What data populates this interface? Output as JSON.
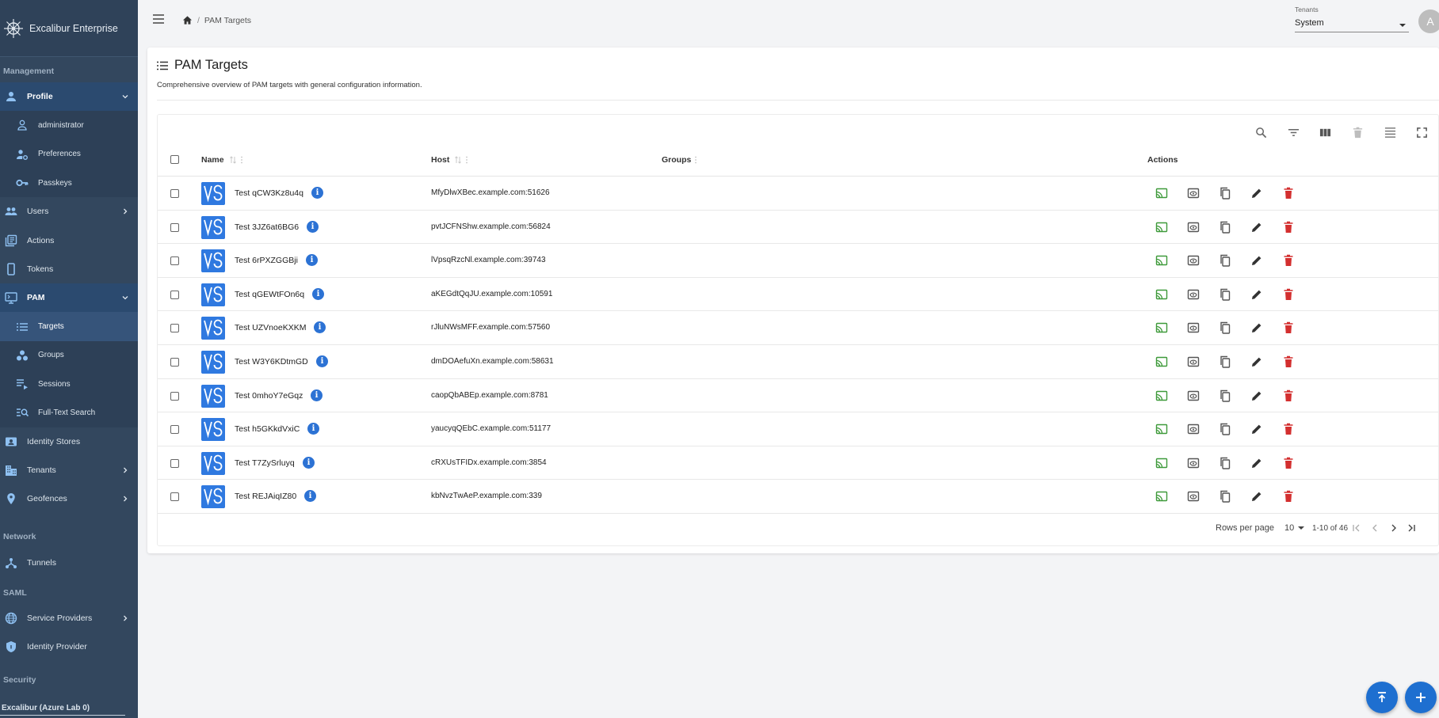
{
  "brand": {
    "name": "Excalibur Enterprise",
    "icon": "ship-wheel-logo"
  },
  "sidebar": {
    "sections": {
      "management": "Management",
      "network": "Network",
      "saml": "SAML",
      "security": "Security"
    },
    "items": [
      {
        "label": "Profile",
        "icon": "person-icon",
        "expanded": true
      },
      {
        "label": "administrator",
        "icon": "person-outline-icon"
      },
      {
        "label": "Preferences",
        "icon": "person-settings-icon"
      },
      {
        "label": "Passkeys",
        "icon": "key-icon"
      },
      {
        "label": "Users",
        "icon": "people-icon"
      },
      {
        "label": "Actions",
        "icon": "library-icon"
      },
      {
        "label": "Tokens",
        "icon": "phone-icon"
      },
      {
        "label": "PAM",
        "icon": "cast-screen-icon",
        "expanded": true
      },
      {
        "label": "Targets",
        "icon": "list-icon",
        "selected": true
      },
      {
        "label": "Groups",
        "icon": "workspaces-icon"
      },
      {
        "label": "Sessions",
        "icon": "playlist-play-icon"
      },
      {
        "label": "Full-Text Search",
        "icon": "manage-search-icon"
      },
      {
        "label": "Identity Stores",
        "icon": "contact-card-icon"
      },
      {
        "label": "Tenants",
        "icon": "domain-icon"
      },
      {
        "label": "Geofences",
        "icon": "location-pin-icon"
      },
      {
        "label": "Tunnels",
        "icon": "hub-icon"
      },
      {
        "label": "Service Providers",
        "icon": "globe-icon"
      },
      {
        "label": "Identity Provider",
        "icon": "shield-icon"
      }
    ],
    "footer": "Excalibur (Azure Lab 0)"
  },
  "topbar": {
    "breadcrumb": "PAM Targets",
    "tenants_label": "Tenants",
    "tenant_value": "System",
    "avatar_letter": "A"
  },
  "page": {
    "title": "PAM Targets",
    "description": "Comprehensive overview of PAM targets with general configuration information."
  },
  "table": {
    "columns": {
      "name": "Name",
      "host": "Host",
      "groups": "Groups",
      "actions": "Actions"
    },
    "toolbar": [
      "search-icon",
      "filter-icon",
      "columns-icon",
      "delete-icon",
      "density-icon",
      "fullscreen-icon"
    ],
    "rows": [
      {
        "name": "Test qCW3Kz8u4q",
        "host": "MfyDlwXBec.example.com:51626"
      },
      {
        "name": "Test 3JZ6at6BG6",
        "host": "pvtJCFNShw.example.com:56824"
      },
      {
        "name": "Test 6rPXZGGBji",
        "host": "lVpsqRzcNl.example.com:39743"
      },
      {
        "name": "Test qGEWtFOn6q",
        "host": "aKEGdtQqJU.example.com:10591"
      },
      {
        "name": "Test UZVnoeKXKM",
        "host": "rJluNWsMFF.example.com:57560"
      },
      {
        "name": "Test W3Y6KDtmGD",
        "host": "dmDOAefuXn.example.com:58631"
      },
      {
        "name": "Test 0mhoY7eGqz",
        "host": "caopQbABEp.example.com:8781"
      },
      {
        "name": "Test h5GKkdVxiC",
        "host": "yaucyqQEbC.example.com:51177"
      },
      {
        "name": "Test T7ZySrluyq",
        "host": "cRXUsTFIDx.example.com:3854"
      },
      {
        "name": "Test REJAiqIZ80",
        "host": "kbNvzTwAeP.example.com:339"
      }
    ],
    "info_glyph": "i",
    "row_actions": [
      "connect-icon",
      "preview-icon",
      "copy-icon",
      "edit-icon",
      "delete-icon"
    ],
    "pagination": {
      "rows_per_page_label": "Rows per page",
      "rows_per_page": "10",
      "range": "1-10 of 46"
    }
  },
  "colors": {
    "sidebar_bg": "#33475e",
    "accent": "#2f79e0",
    "connect": "#3e9a3a",
    "delete": "#d32f2f",
    "fab": "#1e6fd0"
  }
}
